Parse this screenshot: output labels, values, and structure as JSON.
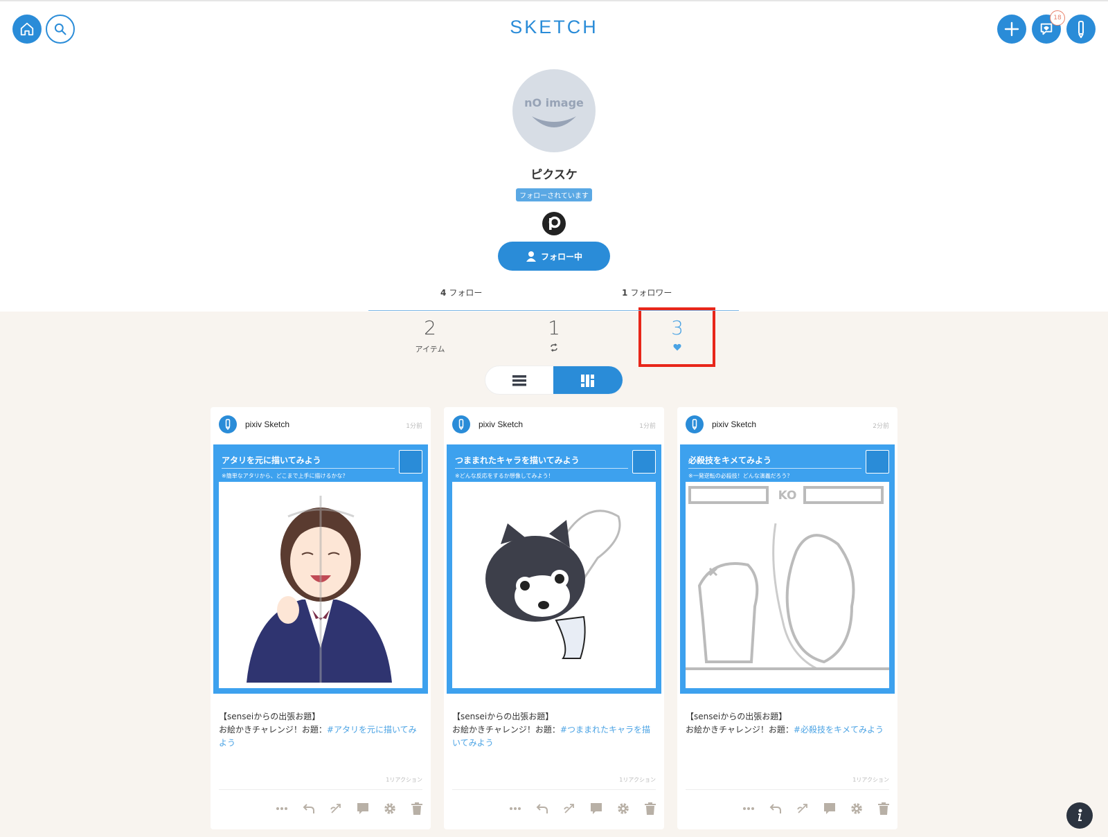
{
  "header": {
    "logo": "SKETCH",
    "notification_count": "18",
    "icons": [
      "home-icon",
      "search-icon",
      "plus-icon",
      "chat-icon",
      "pen-icon"
    ]
  },
  "profile": {
    "avatar_text": "nO image",
    "username": "ピクスケ",
    "followed_label": "フォローされています",
    "follow_button_label": "フォロー中",
    "following_count": "4",
    "following_label": "フォロー",
    "followers_count": "1",
    "followers_label": "フォロワー"
  },
  "tabs": {
    "items": {
      "count": "2",
      "label": "アイテム"
    },
    "reposts": {
      "count": "1"
    },
    "likes": {
      "count": "3"
    }
  },
  "view_toggle": {
    "selected": "grid"
  },
  "cards": [
    {
      "author": "pixiv Sketch",
      "time": "1分前",
      "image_title": "アタリを元に描いてみよう",
      "image_sub": "※簡単なアタリから、どこまで上手に描けるかな？",
      "text_line1": "【senseiからの出張お題】",
      "text_prefix": "お絵かきチャレンジ！お題：",
      "tag": "#アタリを元に描いてみよう",
      "reactions": "1リアクション"
    },
    {
      "author": "pixiv Sketch",
      "time": "1分前",
      "image_title": "つままれたキャラを描いてみよう",
      "image_sub": "※どんな反応をするか想像してみよう！",
      "text_line1": "【senseiからの出張お題】",
      "text_prefix": "お絵かきチャレンジ！お題：",
      "tag": "#つままれたキャラを描いてみよう",
      "reactions": "1リアクション"
    },
    {
      "author": "pixiv Sketch",
      "time": "2分前",
      "image_title": "必殺技をキメてみよう",
      "image_sub": "※一発逆転の必殺技！どんな演義だろう？",
      "text_line1": "【senseiからの出張お題】",
      "text_prefix": "お絵かきチャレンジ！お題：",
      "tag": "#必殺技をキメてみよう",
      "reactions": "1リアクション",
      "ko_text": "KO"
    }
  ],
  "colors": {
    "accent": "#2a8cd8",
    "background": "#f8f4ef",
    "highlight": "#e8261a",
    "badge": "#e8826b"
  }
}
